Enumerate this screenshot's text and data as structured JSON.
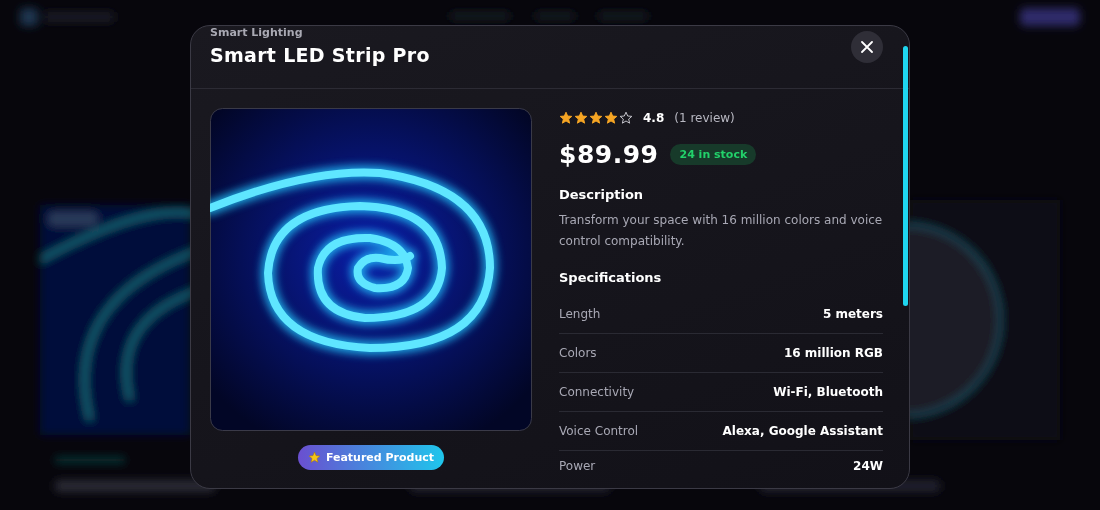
{
  "modal": {
    "category": "Smart Lighting",
    "title": "Smart LED Strip Pro",
    "badge": "Featured Product",
    "rating": {
      "stars": 4,
      "score": "4.8",
      "reviews": "(1 review)"
    },
    "price": "$89.99",
    "stock": "24 in stock",
    "description": {
      "heading": "Description",
      "text": "Transform your space with 16 million colors and voice control compatibility."
    },
    "specifications": {
      "heading": "Specifications",
      "rows": [
        {
          "label": "Length",
          "value": "5 meters"
        },
        {
          "label": "Colors",
          "value": "16 million RGB"
        },
        {
          "label": "Connectivity",
          "value": "Wi-Fi, Bluetooth"
        },
        {
          "label": "Voice Control",
          "value": "Alexa, Google Assistant"
        },
        {
          "label": "Power",
          "value": "24W"
        }
      ]
    }
  }
}
